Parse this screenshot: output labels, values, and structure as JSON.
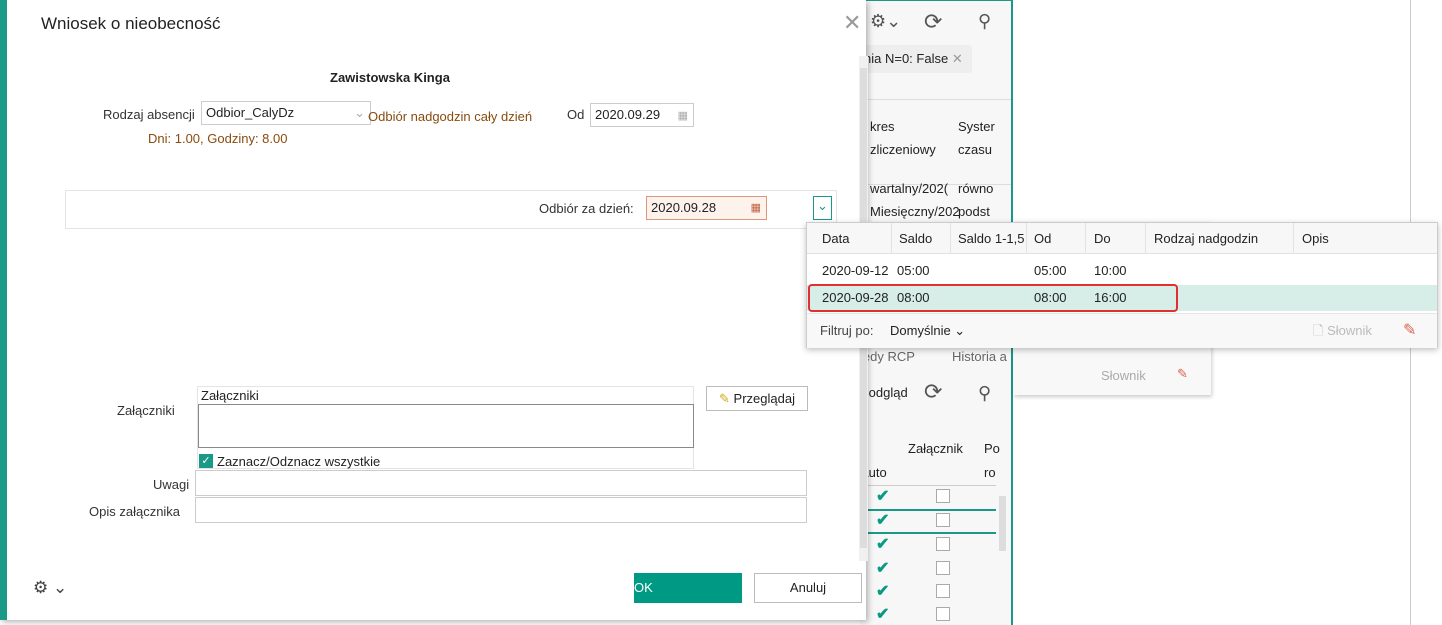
{
  "dialog": {
    "title": "Wniosek o nieobecność",
    "employee": "Zawistowska Kinga",
    "absence_type_label": "Rodzaj absencji",
    "absence_type_value": "Odbior_CalyDz",
    "absence_desc": "Odbiór nadgodzin cały dzień",
    "from_label": "Od",
    "from_value": "2020.09.29",
    "summary": "Dni: 1.00, Godziny: 8.00",
    "pickup_label": "Odbiór za dzień:",
    "pickup_value": "2020.09.28",
    "attachments_label": "Załączniki",
    "attachments_header": "Załączniki",
    "browse_label": "Przeglądaj",
    "select_all_label": "Zaznacz/Odznacz wszystkie",
    "remarks_label": "Uwagi",
    "attachment_desc_label": "Opis załącznika",
    "ok_label": "OK",
    "cancel_label": "Anuluj"
  },
  "background": {
    "filter_chip": "nia  N=0: False",
    "col1a": "kres",
    "col1b": "zliczeniowy",
    "col2a": "Syster",
    "col2b": "czasu",
    "row1a": "wartalny/202(",
    "row1b": "równo",
    "row2a": "Miesięczny/202",
    "row2b": "podst",
    "tab1": "łędy RCP",
    "tab2": "Historia a",
    "preview": "Podgląd",
    "att_col": "Załącznik",
    "col_auto": "Auto",
    "col_p": "Po",
    "col_p2": "ro",
    "dict": "Słownik"
  },
  "popup": {
    "columns": [
      "Data",
      "Saldo",
      "Saldo 1-1,5",
      "Od",
      "Do",
      "Rodzaj nadgodzin",
      "Opis"
    ],
    "rows": [
      [
        "2020-09-12",
        "05:00",
        "",
        "05:00",
        "10:00",
        "",
        ""
      ],
      [
        "2020-09-28",
        "08:00",
        "",
        "08:00",
        "16:00",
        "",
        ""
      ]
    ],
    "filter_label": "Filtruj po:",
    "filter_value": "Domyślnie",
    "dict_label": "Słownik"
  },
  "colors": {
    "accent": "#009a84",
    "highlight": "#d6ede8",
    "error": "#e03030"
  }
}
